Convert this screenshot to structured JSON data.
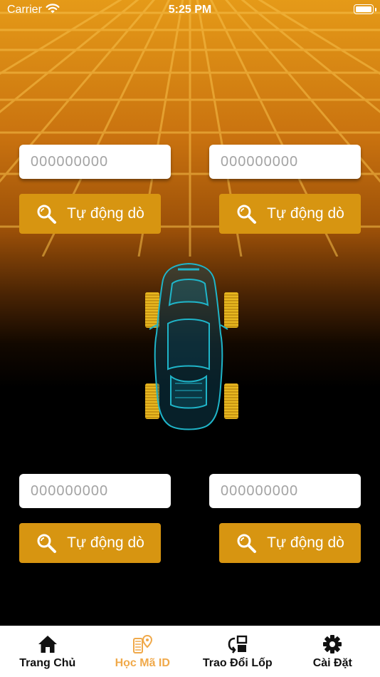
{
  "status_bar": {
    "carrier": "Carrier",
    "time": "5:25 PM"
  },
  "tire_inputs": {
    "front_left": {
      "placeholder": "000000000",
      "button_label": "Tự động dò"
    },
    "front_right": {
      "placeholder": "000000000",
      "button_label": "Tự động dò"
    },
    "rear_left": {
      "placeholder": "000000000",
      "button_label": "Tự động dò"
    },
    "rear_right": {
      "placeholder": "000000000",
      "button_label": "Tự động dò"
    }
  },
  "tab_bar": {
    "active_color": "#f0a94a",
    "items": [
      {
        "label": "Trang Chủ",
        "icon": "home-icon"
      },
      {
        "label": "Học Mã ID",
        "icon": "tire-pin-icon",
        "active": true
      },
      {
        "label": "Trao Đổi Lốp",
        "icon": "swap-icon"
      },
      {
        "label": "Cài Đặt",
        "icon": "gear-icon"
      }
    ]
  },
  "colors": {
    "accent": "#d79511",
    "background_top": "#e59a18",
    "background_bottom": "#000000",
    "car_outline": "#1fb5c9",
    "tire": "#e8b820"
  }
}
